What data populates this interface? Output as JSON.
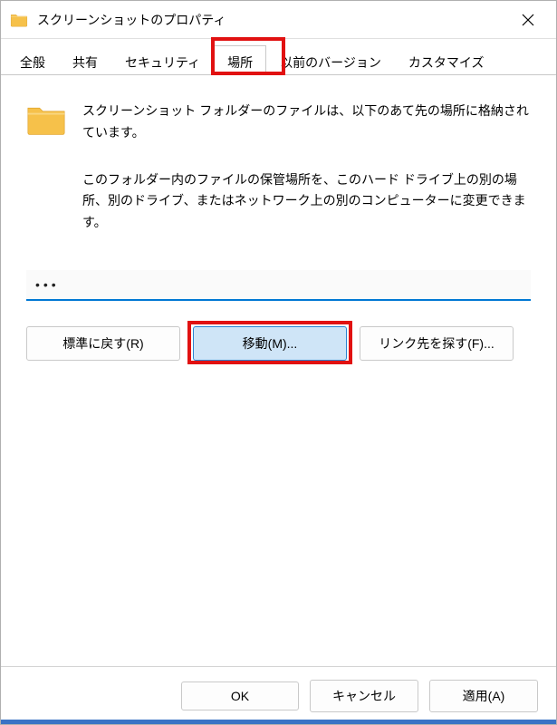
{
  "window": {
    "title": "スクリーンショットのプロパティ"
  },
  "tabs": {
    "general": "全般",
    "sharing": "共有",
    "security": "セキュリティ",
    "location": "場所",
    "previous_versions": "以前のバージョン",
    "customize": "カスタマイズ",
    "active": "location"
  },
  "body": {
    "line1": "スクリーンショット フォルダーのファイルは、以下のあて先の場所に格納されています。",
    "line2": "このフォルダー内のファイルの保管場所を、このハード ドライブ上の別の場所、別のドライブ、またはネットワーク上の別のコンピューターに変更できます。"
  },
  "path_field": {
    "value": "•••"
  },
  "buttons": {
    "restore_default": "標準に戻す(R)",
    "move": "移動(M)...",
    "find_target": "リンク先を探す(F)..."
  },
  "footer": {
    "ok": "OK",
    "cancel": "キャンセル",
    "apply": "適用(A)"
  },
  "highlights": {
    "tab_location": true,
    "move_button": true
  },
  "colors": {
    "highlight_red": "#e11111",
    "focus_blue": "#0078d4",
    "button_hl_bg": "#cfe5f7",
    "button_hl_border": "#2a84d1"
  }
}
